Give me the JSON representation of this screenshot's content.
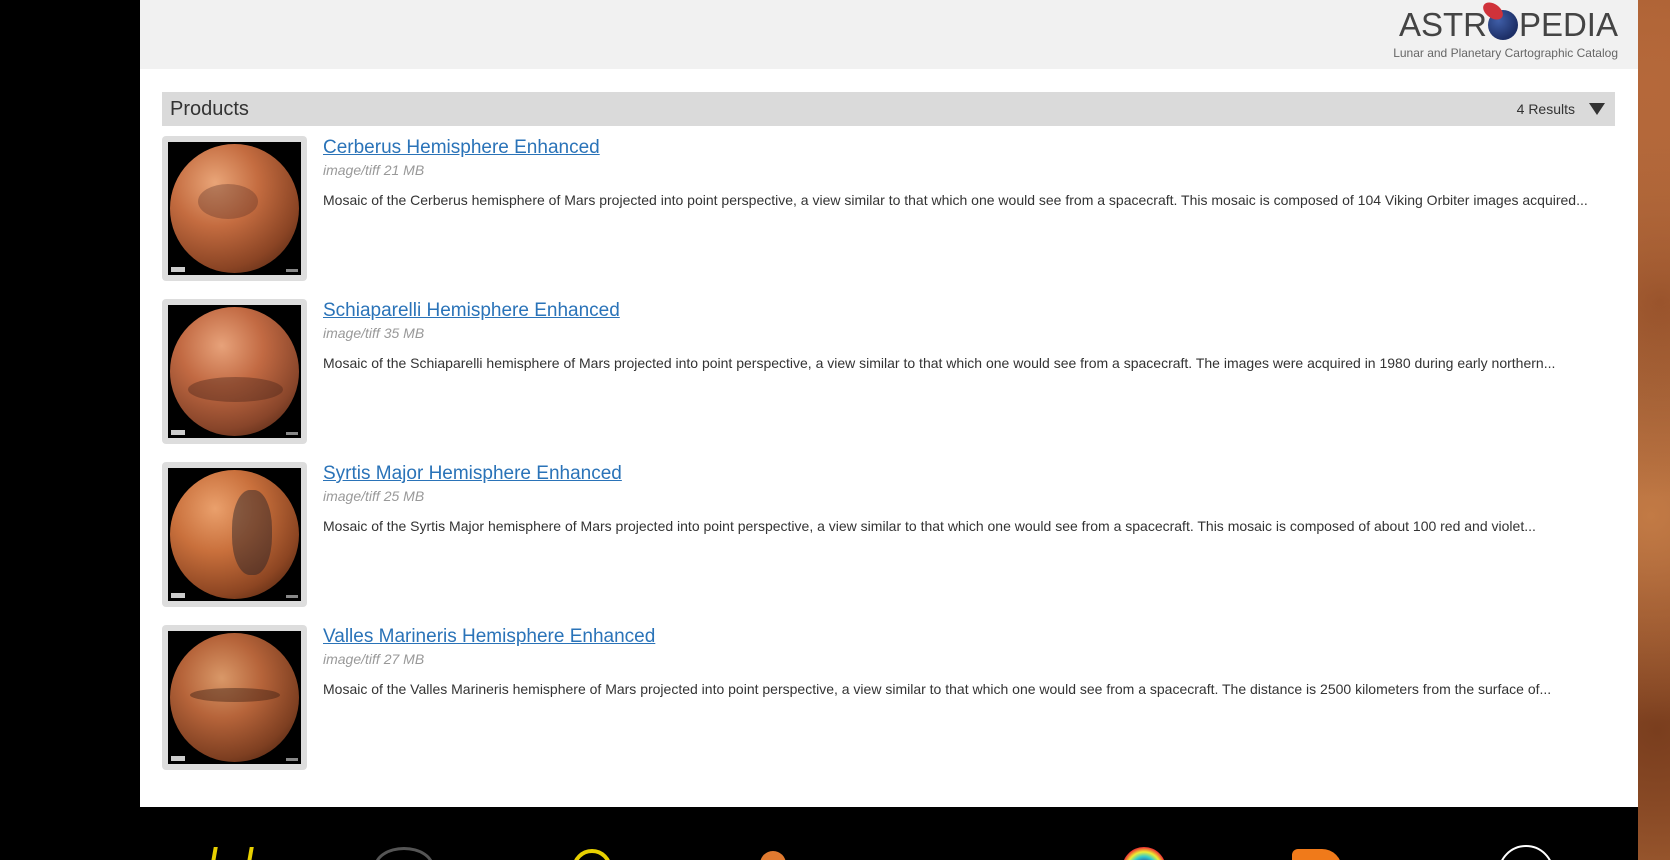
{
  "header": {
    "logo_text_left": "ASTR",
    "logo_text_right": "PEDIA",
    "logo_subtitle": "Lunar and Planetary Cartographic Catalog"
  },
  "products": {
    "title": "Products",
    "results_count": "4 Results"
  },
  "items": [
    {
      "title": "Cerberus Hemisphere Enhanced",
      "meta": "image/tiff 21 MB",
      "description": "Mosaic of the Cerberus hemisphere of Mars projected into point perspective, a view similar to that which one would see from a spacecraft. This mosaic is composed of 104 Viking Orbiter images acquired..."
    },
    {
      "title": "Schiaparelli Hemisphere Enhanced",
      "meta": "image/tiff 35 MB",
      "description": "Mosaic of the Schiaparelli hemisphere of Mars projected into point perspective, a view similar to that which one would see from a spacecraft. The images were acquired in 1980 during early northern..."
    },
    {
      "title": "Syrtis Major Hemisphere Enhanced",
      "meta": "image/tiff 25 MB",
      "description": "Mosaic of the Syrtis Major hemisphere of Mars projected into point perspective, a view similar to that which one would see from a spacecraft. This mosaic is composed of about 100 red and violet..."
    },
    {
      "title": "Valles Marineris Hemisphere Enhanced",
      "meta": "image/tiff 27 MB",
      "description": "Mosaic of the Valles Marineris hemisphere of Mars projected into point perspective, a view similar to that which one would see from a spacecraft. The distance is 2500 kilometers from the surface of..."
    }
  ],
  "colors": {
    "link": "#2a73b8",
    "header_bg": "#f1f1f1",
    "bar_bg": "#dadada"
  }
}
